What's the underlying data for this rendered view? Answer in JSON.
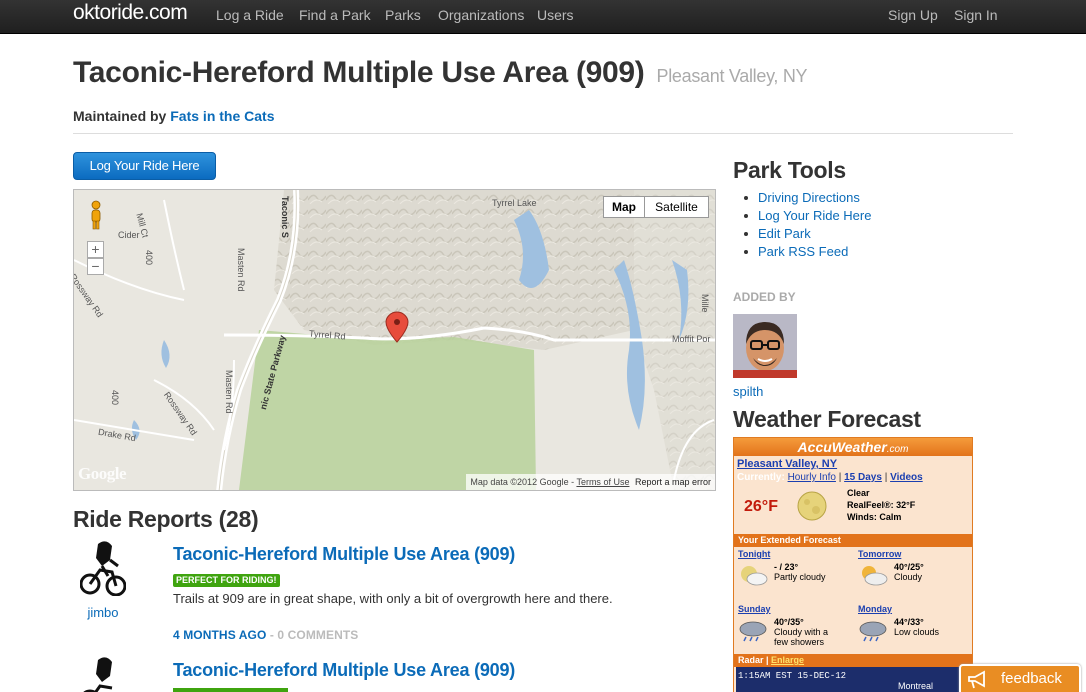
{
  "nav": {
    "brand": "oktoride.com",
    "links": [
      "Log a Ride",
      "Find a Park",
      "Parks",
      "Organizations",
      "Users"
    ],
    "right": [
      "Sign Up",
      "Sign In"
    ]
  },
  "park": {
    "title": "Taconic-Hereford Multiple Use Area (909)",
    "location": "Pleasant Valley, NY",
    "maintained_prefix": "Maintained by",
    "maintained_org": "Fats in the Cats"
  },
  "log_button": "Log Your Ride Here",
  "map": {
    "types": [
      "Map",
      "Satellite"
    ],
    "active_type": "Map",
    "zoom_in": "+",
    "zoom_out": "−",
    "attribution": "Map data ©2012 Google -",
    "terms": "Terms of Use",
    "report": "Report a map error",
    "logo": "Google",
    "labels": [
      "Tyrrel Lake",
      "Taconic S",
      "Masten Rd",
      "Tyrrel Rd",
      "Rossway Rd",
      "Drake Rd",
      "Moffit Por",
      "Cider",
      "Mill Ct",
      "Rossway Rd",
      "Masten Rd",
      "nic State Parkway",
      "400",
      "Mille",
      "400"
    ]
  },
  "ride_reports": {
    "heading": "Ride Reports (28)",
    "items": [
      {
        "user": "jimbo",
        "title": "Taconic-Hereford Multiple Use Area (909)",
        "condition": "PERFECT FOR RIDING!",
        "body": "Trails at 909 are in great shape, with only a bit of overgrowth here and there.",
        "ago": "4 MONTHS AGO",
        "comments": "- 0 COMMENTS"
      },
      {
        "user": "",
        "title": "Taconic-Hereford Multiple Use Area (909)",
        "condition": "",
        "body": "",
        "ago": "",
        "comments": ""
      }
    ]
  },
  "sidebar": {
    "tools_heading": "Park Tools",
    "tools": [
      "Driving Directions",
      "Log Your Ride Here",
      "Edit Park",
      "Park RSS Feed"
    ],
    "added_by_heading": "ADDED BY",
    "added_by_user": "spilth",
    "weather_heading": "Weather Forecast"
  },
  "weather": {
    "brand": "AccuWeather",
    "brand_suffix": ".com",
    "location": "Pleasant Valley, NY",
    "currently": "Currently:",
    "links": [
      "Hourly Info",
      "15 Days",
      "Videos"
    ],
    "sep": "|",
    "temp": "26°F",
    "condition": "Clear",
    "realfeel": "RealFeel®: 32°F",
    "winds": "Winds: Calm",
    "extended": "Your Extended Forecast",
    "days": [
      {
        "name": "Tonight",
        "temps": "- / 23°",
        "desc": "Partly cloudy"
      },
      {
        "name": "Tomorrow",
        "temps": "40°/25°",
        "desc": "Cloudy"
      },
      {
        "name": "Sunday",
        "temps": "40°/35°",
        "desc": "Cloudy with a few showers"
      },
      {
        "name": "Monday",
        "temps": "44°/33°",
        "desc": "Low clouds"
      }
    ],
    "radar": "Radar",
    "enlarge": "Enlarge",
    "radar_time": "1:15AM EST 15-DEC-12",
    "radar_city": "Montreal"
  },
  "feedback": "feedback"
}
